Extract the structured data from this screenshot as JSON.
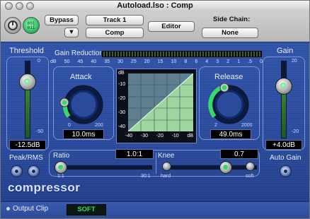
{
  "window": {
    "title": "Autoload.lso : Comp"
  },
  "header": {
    "bypass_label": "Bypass",
    "track_label": "Track 1",
    "plugin_label": "Comp",
    "editor_label": "Editor",
    "side_chain_label": "Side Chain:",
    "side_chain_value": "None",
    "power_icon_text": "001\n011"
  },
  "plugin": {
    "name": "compressor",
    "threshold": {
      "label": "Threshold",
      "top_tick": "0",
      "bottom_tick": "-50",
      "value": "-12.5dB",
      "level": 0.25
    },
    "gain_reduction": {
      "label": "Gain Reduction",
      "scale": [
        "dB",
        "50",
        "45",
        "40",
        "35",
        "30",
        "25",
        "20",
        "15",
        "10",
        "8",
        "6",
        "4",
        "3",
        "2",
        "1",
        ".5",
        "0"
      ]
    },
    "attack": {
      "label": "Attack",
      "min": "0",
      "max": "200",
      "value": "10.0ms"
    },
    "release": {
      "label": "Release",
      "min": "2",
      "max": "2000",
      "value": "49.0ms"
    },
    "graph": {
      "unit": "dB",
      "y_ticks": [
        "-10",
        "-20",
        "-30",
        "-40"
      ],
      "x_ticks": [
        "-40",
        "-30",
        "-20",
        "-10",
        "dB"
      ]
    },
    "gain": {
      "label": "Gain",
      "top_tick": "20",
      "bottom_tick": "-20",
      "value": "+4.0dB",
      "level": 0.6
    },
    "peak_rms": {
      "label": "Peak/RMS"
    },
    "ratio": {
      "label": "Ratio",
      "value": "1.0:1",
      "min": "1:1",
      "max": "30:1"
    },
    "knee": {
      "label": "Knee",
      "value": "0.7",
      "min": "hard",
      "max": "soft"
    },
    "auto_gain": {
      "label": "Auto Gain"
    }
  },
  "footer": {
    "output_clip_label": "Output Clip",
    "soft_label": "SOFT"
  },
  "colors": {
    "accent_green": "#38d96b",
    "panel_blue": "#2f52a8",
    "graph_green": "#9fd6a0"
  }
}
